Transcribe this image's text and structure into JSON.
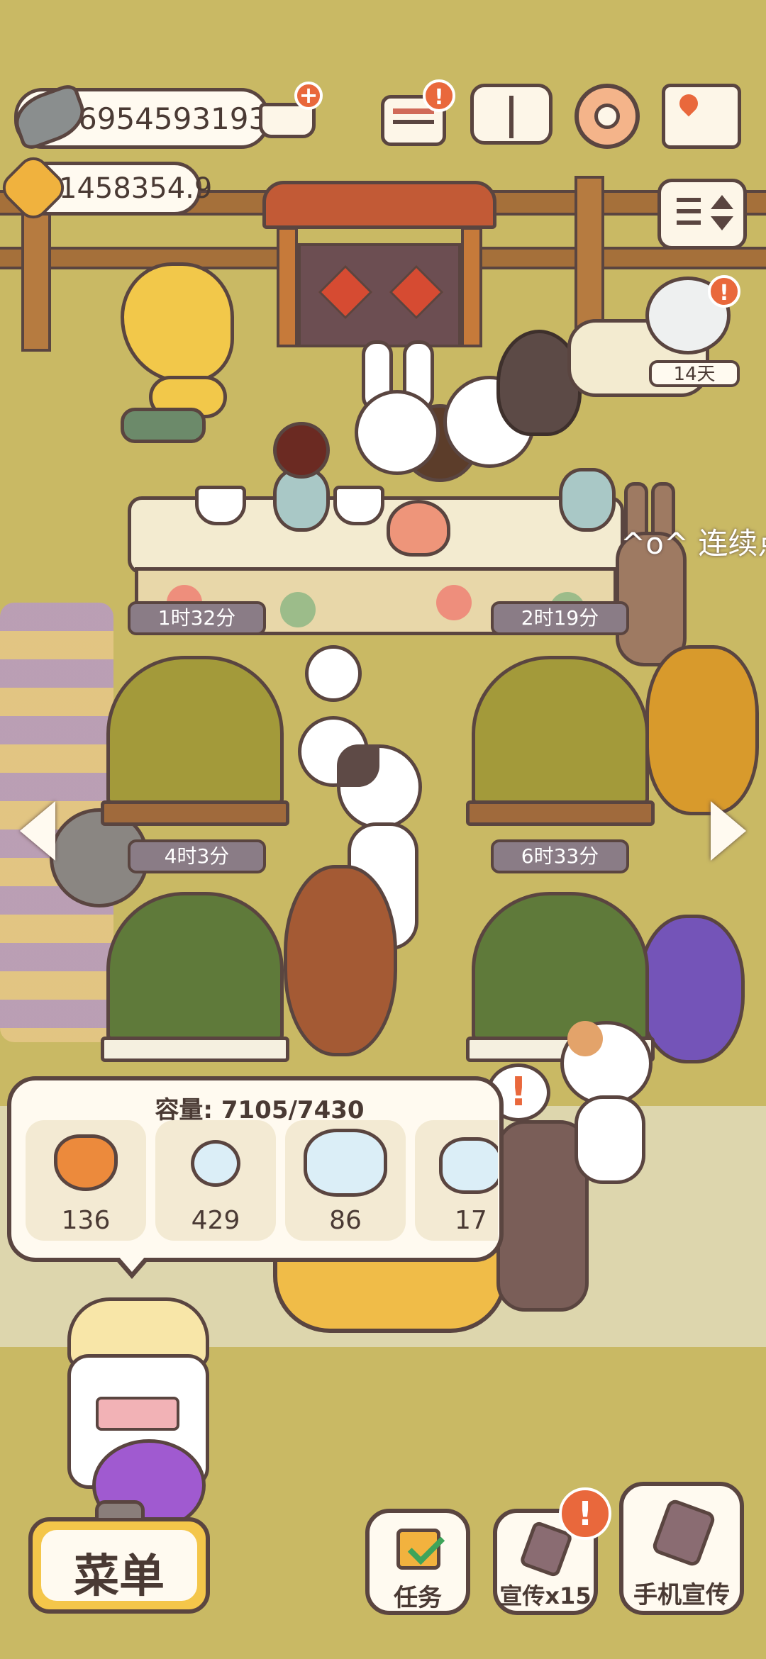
{
  "currency": {
    "fish": "6954593193",
    "stars": "1458354.9"
  },
  "badge_mark": "!",
  "stall_timer": "14天",
  "scroll_text": "^o^ 连续点",
  "timers": [
    "1时32分",
    "2时19分",
    "4时3分",
    "6时33分"
  ],
  "storage": {
    "capacity_label": "容量: 7105/7430",
    "items": [
      {
        "icon": "maple-flower-icon",
        "count": "136"
      },
      {
        "icon": "white-flower-icon",
        "count": "429"
      },
      {
        "icon": "flower-bunch-icon",
        "count": "86"
      },
      {
        "icon": "flower-cluster-icon",
        "count": "17"
      }
    ]
  },
  "buttons": {
    "menu": "菜单",
    "tasks": "任务",
    "promote": "宣传x15",
    "phone_promote": "手机宣传"
  },
  "colors": {
    "ground": "#c9b964",
    "accent_badge": "#e9683c",
    "outline": "#5a4540",
    "panel": "#fffaf0",
    "menu_border": "#f4c64a"
  }
}
